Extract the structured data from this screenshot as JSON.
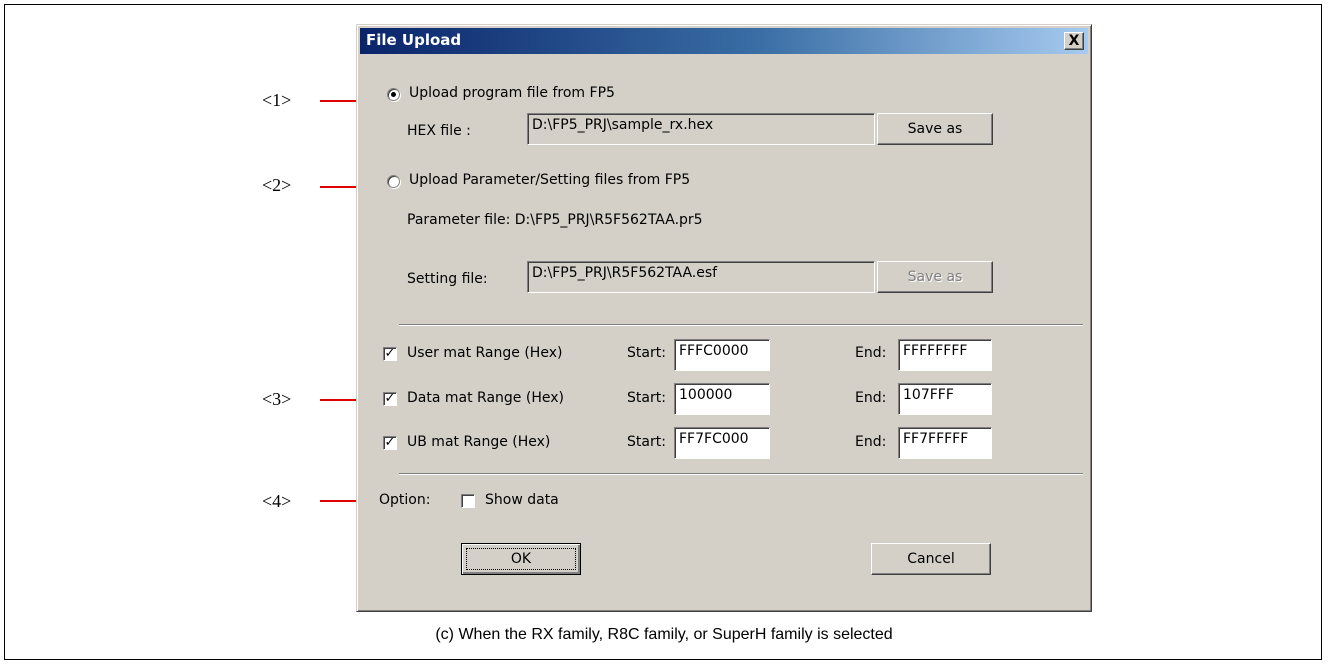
{
  "dialog": {
    "title": "File Upload",
    "close_label": "X",
    "upload_program": {
      "label": "Upload program file from FP5",
      "selected": true,
      "hex_label": "HEX file :",
      "hex_value": "D:\\FP5_PRJ\\sample_rx.hex",
      "save_as": "Save as"
    },
    "upload_params": {
      "label": "Upload Parameter/Setting files from FP5",
      "selected": false,
      "parameter_file": "Parameter file: D:\\FP5_PRJ\\R5F562TAA.pr5",
      "setting_label": "Setting file:",
      "setting_value": "D:\\FP5_PRJ\\R5F562TAA.esf",
      "save_as": "Save as"
    },
    "ranges": [
      {
        "label": "User mat Range (Hex)",
        "checked": true,
        "start_label": "Start:",
        "start": "FFFC0000",
        "end_label": "End:",
        "end": "FFFFFFFF"
      },
      {
        "label": "Data mat Range (Hex)",
        "checked": true,
        "start_label": "Start:",
        "start": "100000",
        "end_label": "End:",
        "end": "107FFF"
      },
      {
        "label": "UB mat Range (Hex)",
        "checked": true,
        "start_label": "Start:",
        "start": "FF7FC000",
        "end_label": "End:",
        "end": "FF7FFFFF"
      }
    ],
    "option": {
      "label": "Option:",
      "show_data_label": "Show data",
      "show_data_checked": false
    },
    "ok_label": "OK",
    "cancel_label": "Cancel"
  },
  "callouts": {
    "c1": "<1>",
    "c2": "<2>",
    "c3": "<3>",
    "c4": "<4>"
  },
  "caption": "(c) When the RX family, R8C family, or SuperH family is selected",
  "colors": {
    "arrow": "#e00000",
    "titlebar_start": "#0a246a",
    "dialog_bg": "#d4d0c8"
  }
}
